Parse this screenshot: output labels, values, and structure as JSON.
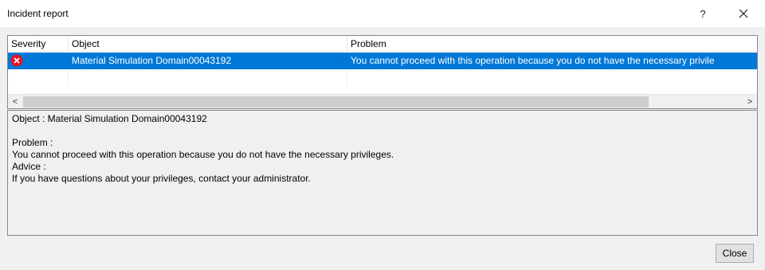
{
  "window": {
    "title": "Incident report",
    "help_label": "?"
  },
  "grid": {
    "columns": [
      "Severity",
      "Object",
      "Problem"
    ],
    "rows": [
      {
        "severity_icon": "error-icon",
        "object": "Material Simulation Domain00043192",
        "problem": "You cannot proceed with this operation because you do not have the necessary privile"
      }
    ]
  },
  "scrollbar": {
    "left_arrow": "<",
    "right_arrow": ">"
  },
  "details": {
    "object_line": "Object : Material Simulation Domain00043192",
    "problem_label": "Problem :",
    "problem_text": "You cannot proceed with this operation because you do not have the necessary privileges.",
    "advice_label": "Advice :",
    "advice_text": "If you have questions about your privileges, contact your administrator."
  },
  "buttons": {
    "close": "Close"
  },
  "colors": {
    "selection": "#0078d7",
    "error_icon": "#e81123",
    "dialog_background": "#f0f0f0"
  }
}
